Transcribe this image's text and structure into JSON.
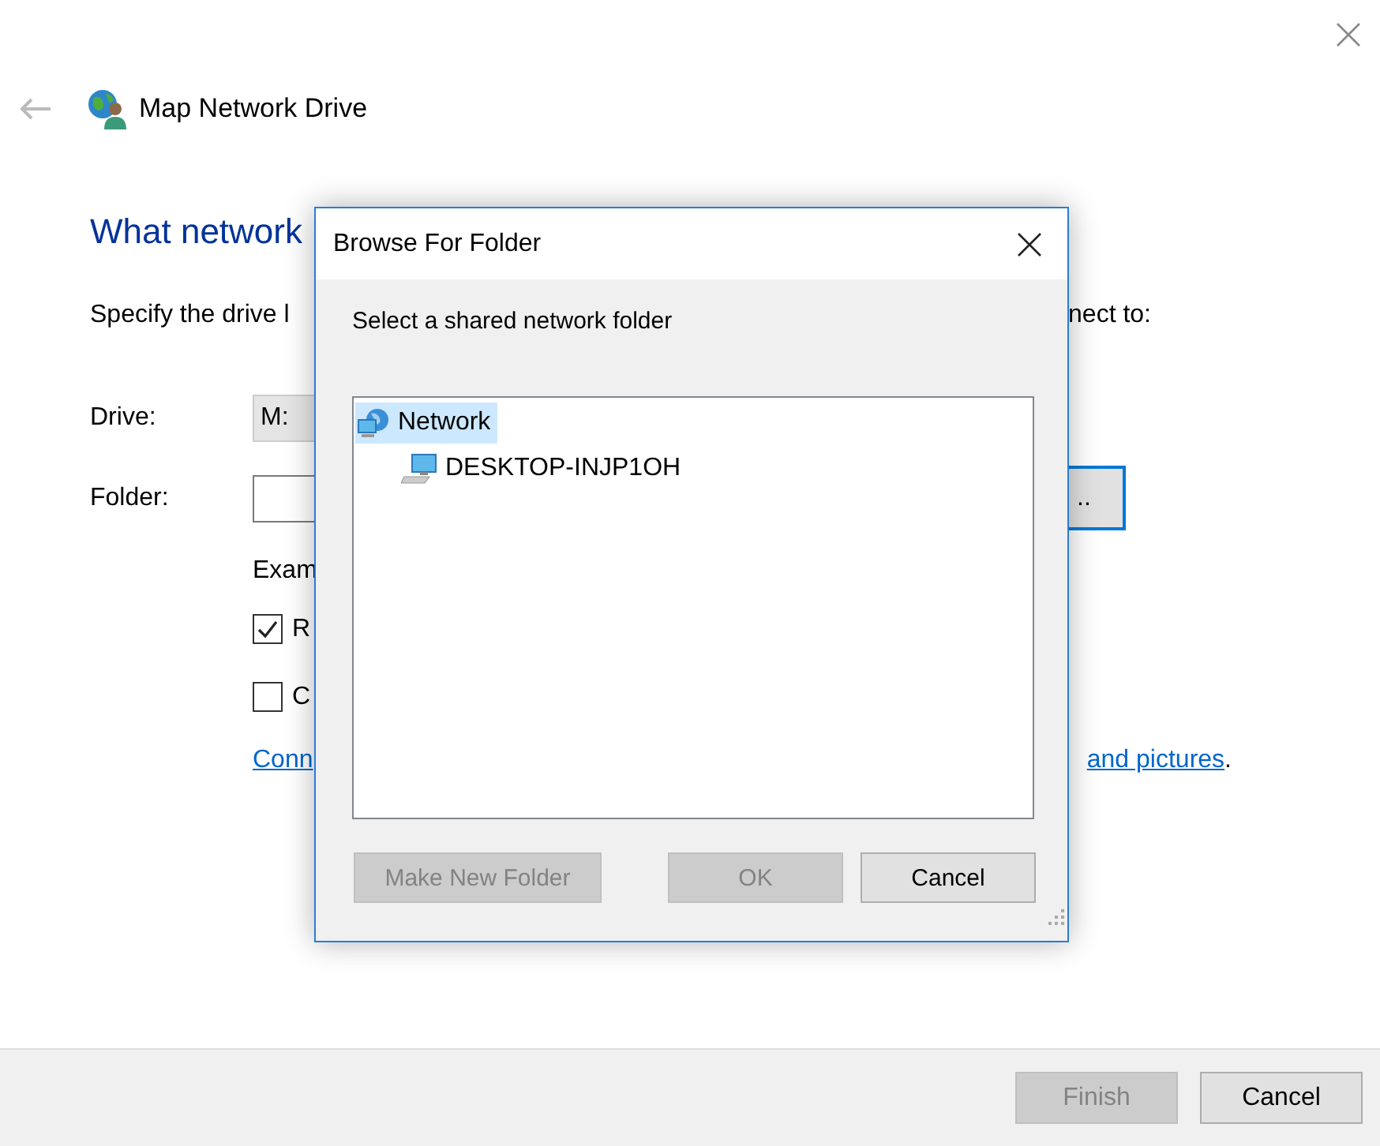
{
  "wizard": {
    "title": "Map Network Drive",
    "heading": "What network",
    "instruction": {
      "left": "Specify the drive l",
      "right": "nect to:"
    },
    "drive": {
      "label": "Drive:",
      "value": "M:"
    },
    "folder": {
      "label": "Folder:",
      "browse_button": ".."
    },
    "example": "Exam",
    "options": [
      {
        "label": "R",
        "checked": true
      },
      {
        "label": "C",
        "checked": false
      }
    ],
    "link": {
      "left": "Conn",
      "right": "and pictures",
      "after": "."
    },
    "buttons": [
      {
        "label": "Finish",
        "disabled": true
      },
      {
        "label": "Cancel",
        "disabled": false
      }
    ]
  },
  "dialog": {
    "title": "Browse For Folder",
    "prompt": "Select a shared network folder",
    "tree": [
      {
        "label": "Network",
        "kind": "network",
        "selected": true,
        "children": [
          {
            "label": "DESKTOP-INJP1OH",
            "kind": "computer",
            "selected": false
          }
        ]
      }
    ],
    "buttons": [
      {
        "label": "Make New Folder",
        "disabled": true
      },
      {
        "label": "OK",
        "disabled": true
      },
      {
        "label": "Cancel",
        "disabled": false
      }
    ]
  }
}
